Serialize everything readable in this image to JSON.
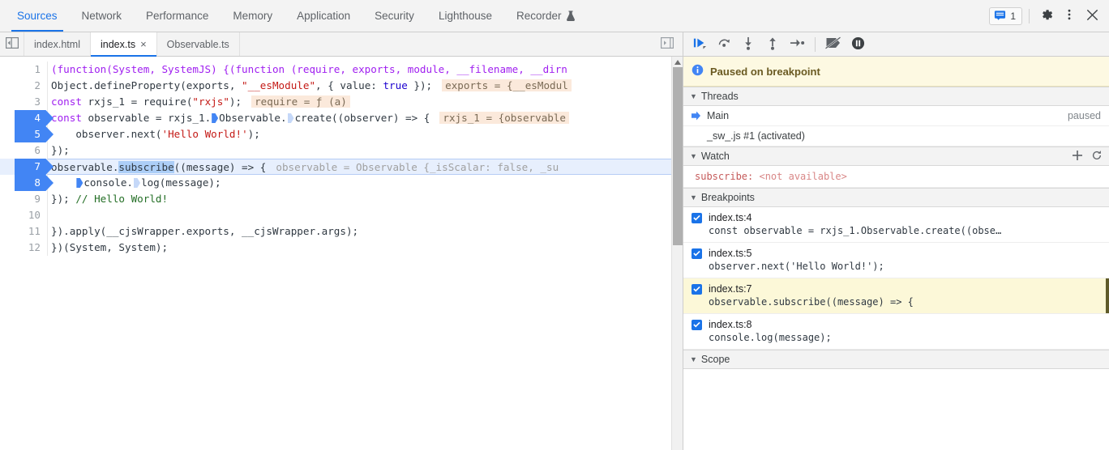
{
  "toolbar": {
    "tabs": [
      {
        "label": "Sources",
        "active": true,
        "icon": null
      },
      {
        "label": "Network",
        "active": false,
        "icon": null
      },
      {
        "label": "Performance",
        "active": false,
        "icon": null
      },
      {
        "label": "Memory",
        "active": false,
        "icon": null
      },
      {
        "label": "Application",
        "active": false,
        "icon": null
      },
      {
        "label": "Security",
        "active": false,
        "icon": null
      },
      {
        "label": "Lighthouse",
        "active": false,
        "icon": null
      },
      {
        "label": "Recorder",
        "active": false,
        "icon": "flask-icon"
      }
    ],
    "issues_count": "1",
    "issues_icon": "message-issues-icon",
    "settings_icon": "gear-icon",
    "more_icon": "more-vertical-icon",
    "close_icon": "close-icon",
    "accent_color": "#1a73e8"
  },
  "filetabs": {
    "nav_icon": "show-navigator-icon",
    "expand_icon": "show-debugger-icon",
    "items": [
      {
        "label": "index.html",
        "active": false,
        "closable": false
      },
      {
        "label": "index.ts",
        "active": true,
        "closable": true
      },
      {
        "label": "Observable.ts",
        "active": false,
        "closable": false
      }
    ],
    "close_glyph": "×"
  },
  "editor": {
    "lines": [
      {
        "n": "1",
        "breakpoint": false,
        "executing": false
      },
      {
        "n": "2",
        "breakpoint": false,
        "executing": false
      },
      {
        "n": "3",
        "breakpoint": false,
        "executing": false
      },
      {
        "n": "4",
        "breakpoint": true,
        "executing": false
      },
      {
        "n": "5",
        "breakpoint": true,
        "executing": false
      },
      {
        "n": "6",
        "breakpoint": false,
        "executing": false
      },
      {
        "n": "7",
        "breakpoint": true,
        "executing": true
      },
      {
        "n": "8",
        "breakpoint": true,
        "executing": false
      },
      {
        "n": "9",
        "breakpoint": false,
        "executing": false
      },
      {
        "n": "10",
        "breakpoint": false,
        "executing": false
      },
      {
        "n": "11",
        "breakpoint": false,
        "executing": false
      },
      {
        "n": "12",
        "breakpoint": false,
        "executing": false
      }
    ],
    "code": {
      "l1": "(function(System, SystemJS) {(function (require, exports, module, __filename, __dirn",
      "l2_a": "Object.defineProperty(exports, ",
      "l2_str": "\"__esModule\"",
      "l2_b": ", { value: ",
      "l2_kw": "true",
      "l2_c": " });",
      "l2_val": "exports = {__esModul",
      "l3_kw": "const",
      "l3_a": " rxjs_1 = require(",
      "l3_str": "\"rxjs\"",
      "l3_b": ");",
      "l3_val": "require = ƒ (a)",
      "l4_kw": "const",
      "l4_a": " observable = rxjs_1.",
      "l4_b": "Observable.",
      "l4_c": "create((observer) => {",
      "l4_val": "rxjs_1 = {observable",
      "l5": "observer.next(",
      "l5_str": "'Hello World!'",
      "l5_b": ");",
      "l6": "});",
      "l7_a": "observable.",
      "l7_sel": "subscribe",
      "l7_b": "((message) => {",
      "l7_val": "observable = Observable {_isScalar: false, _su",
      "l8_a": "console.",
      "l8_b": "log(message);",
      "l9_a": "}); ",
      "l9_com": "// Hello World!",
      "l10": "",
      "l11": "}).apply(__cjsWrapper.exports, __cjsWrapper.args);",
      "l12": "})(System, System);"
    }
  },
  "debugger": {
    "controls": [
      {
        "name": "resume-button",
        "title": "Resume script execution"
      },
      {
        "name": "step-over-button",
        "title": "Step over next function call"
      },
      {
        "name": "step-into-button",
        "title": "Step into next function call"
      },
      {
        "name": "step-out-button",
        "title": "Step out of current function"
      },
      {
        "name": "step-button",
        "title": "Step"
      },
      {
        "name": "deactivate-breakpoints-button",
        "title": "Deactivate breakpoints"
      },
      {
        "name": "pause-on-exceptions-button",
        "title": "Pause on exceptions"
      }
    ],
    "paused_banner": {
      "icon": "info-icon",
      "text": "Paused on breakpoint",
      "background": "#fdf9e2"
    },
    "threads": {
      "title": "Threads",
      "items": [
        {
          "label": "Main",
          "status": "paused",
          "selected": true
        },
        {
          "label": "_sw_.js #1 (activated)",
          "status": "",
          "selected": false
        }
      ]
    },
    "watch": {
      "title": "Watch",
      "add_icon": "plus-icon",
      "refresh_icon": "refresh-icon",
      "entries": [
        {
          "name": "subscribe:",
          "value": "<not available>"
        }
      ]
    },
    "breakpoints": {
      "title": "Breakpoints",
      "items": [
        {
          "location": "index.ts:4",
          "code": "const observable = rxjs_1.Observable.create((obse…",
          "checked": true,
          "active": false
        },
        {
          "location": "index.ts:5",
          "code": "observer.next('Hello World!');",
          "checked": true,
          "active": false
        },
        {
          "location": "index.ts:7",
          "code": "observable.subscribe((message) => {",
          "checked": true,
          "active": true
        },
        {
          "location": "index.ts:8",
          "code": "console.log(message);",
          "checked": true,
          "active": false
        }
      ]
    },
    "scope": {
      "title": "Scope"
    }
  }
}
